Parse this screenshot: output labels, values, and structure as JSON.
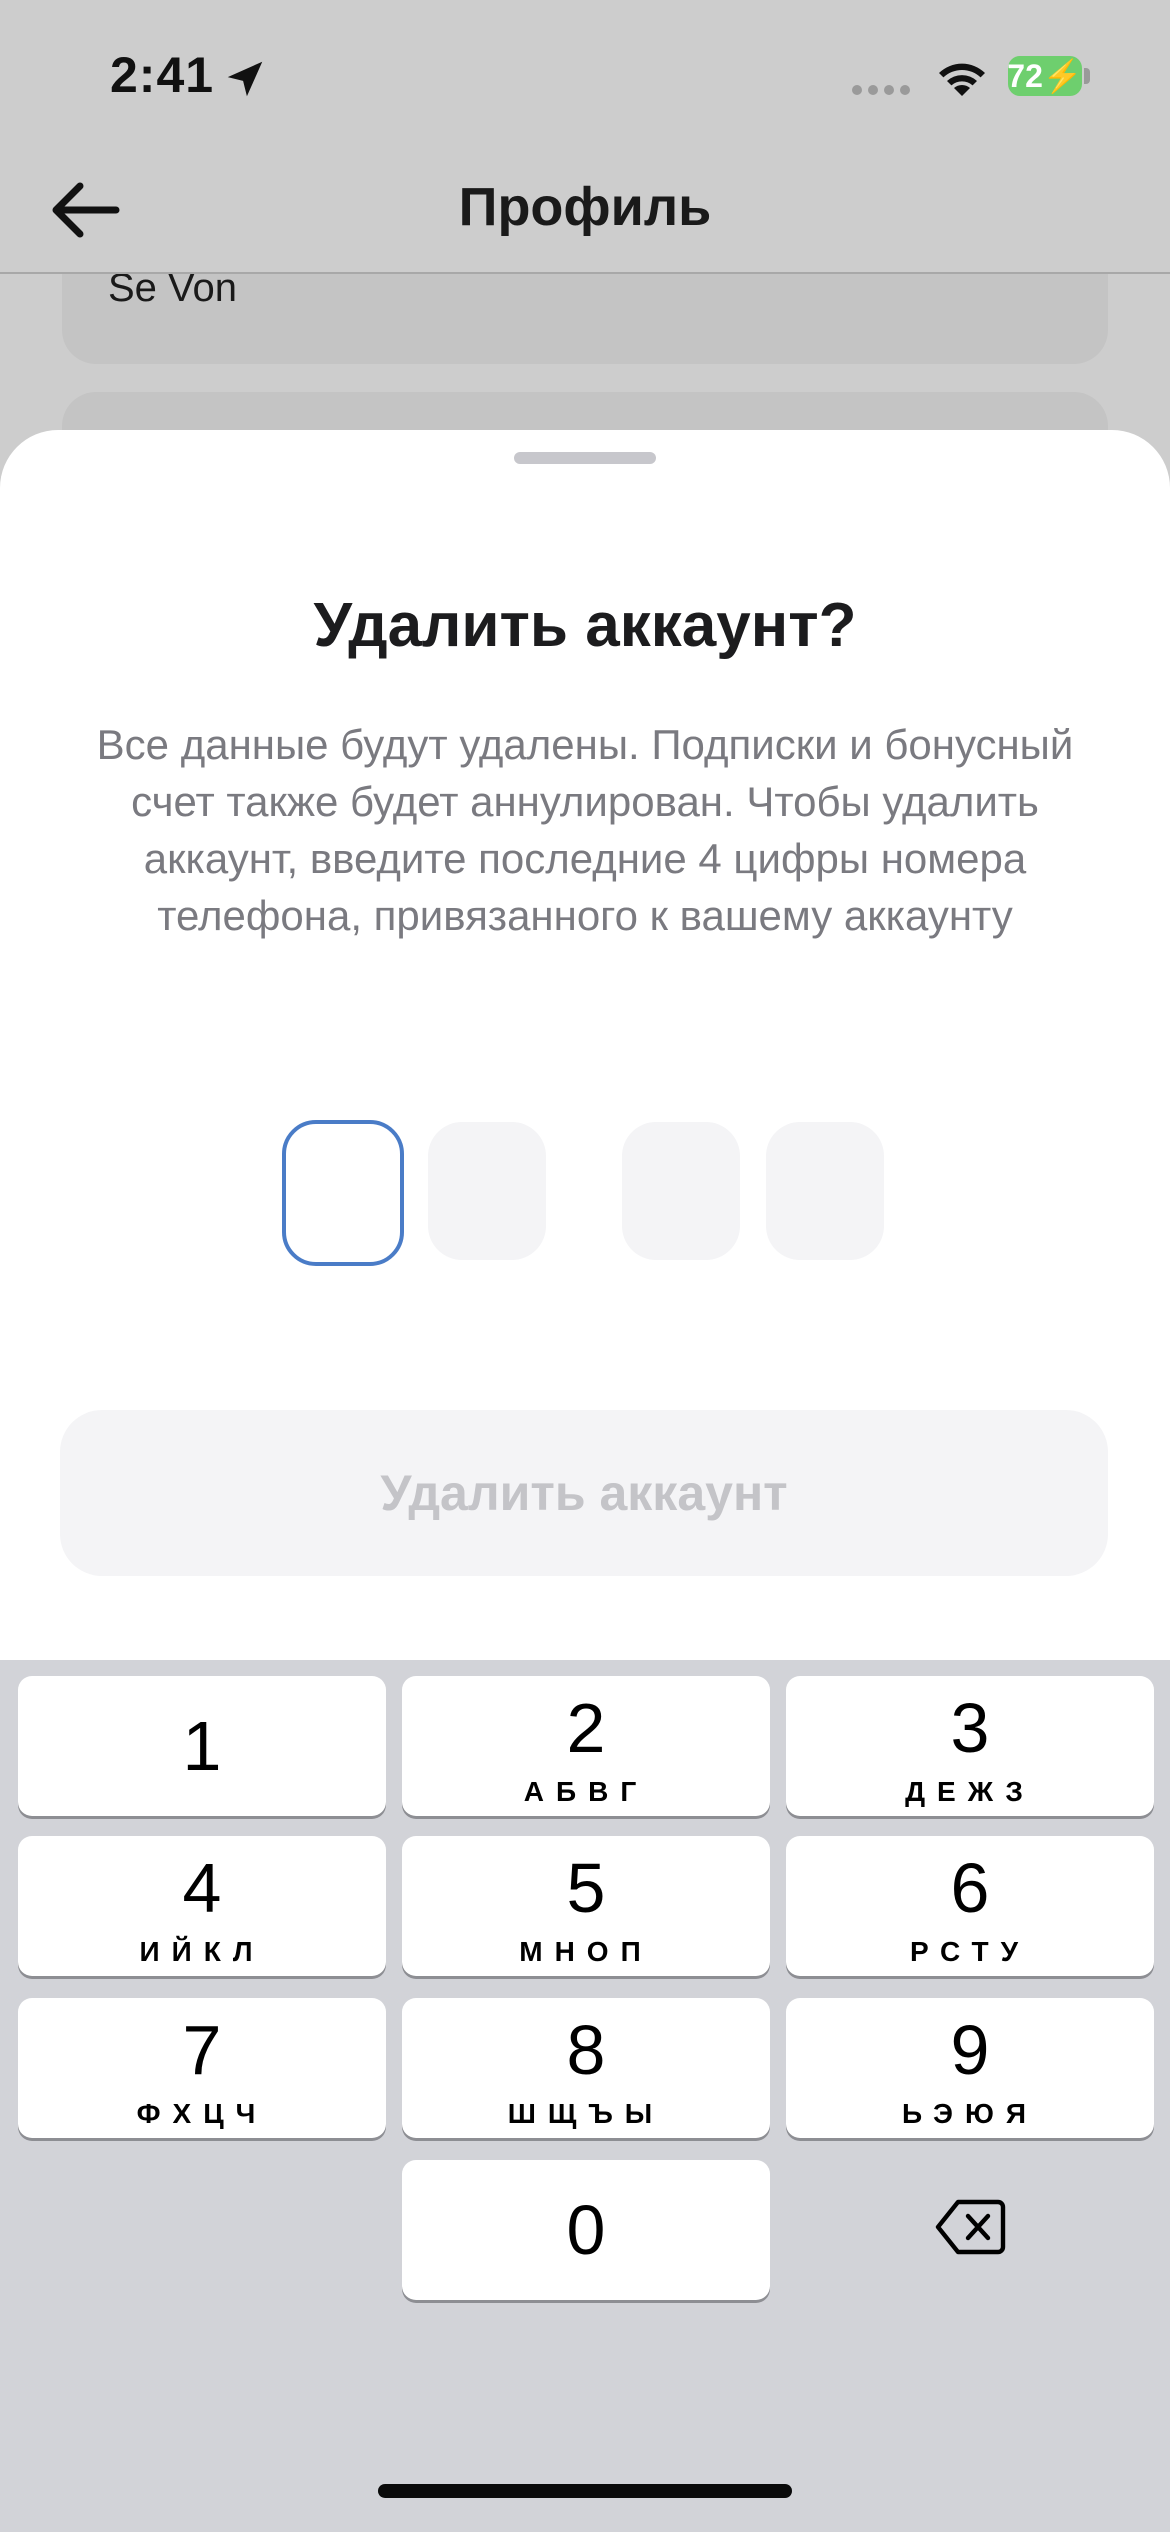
{
  "status_bar": {
    "time": "2:41",
    "battery": "72"
  },
  "nav": {
    "title": "Профиль"
  },
  "background": {
    "card_value": "Se Von"
  },
  "sheet": {
    "title": "Удалить аккаунт?",
    "description": "Все данные будут удалены. Подписки и бонусный счет также будет аннулирован. Чтобы удалить аккаунт, введите последние 4 цифры номера телефона, привязанного к вашему аккаунту",
    "code_digits": [
      "",
      "",
      "",
      ""
    ],
    "delete_button": "Удалить аккаунт"
  },
  "keypad": {
    "keys": [
      {
        "digit": "1",
        "letters": ""
      },
      {
        "digit": "2",
        "letters": "АБВГ"
      },
      {
        "digit": "3",
        "letters": "ДЕЖЗ"
      },
      {
        "digit": "4",
        "letters": "ИЙКЛ"
      },
      {
        "digit": "5",
        "letters": "МНОП"
      },
      {
        "digit": "6",
        "letters": "РСТУ"
      },
      {
        "digit": "7",
        "letters": "ФХЦЧ"
      },
      {
        "digit": "8",
        "letters": "ШЩЪЫ"
      },
      {
        "digit": "9",
        "letters": "ЬЭЮЯ"
      },
      {
        "digit": "0",
        "letters": ""
      }
    ]
  },
  "colors": {
    "accent": "#4a7cc7",
    "sheet_bg": "#ffffff",
    "dim_bg": "#cdcdcd",
    "keypad_bg": "#d2d3d8"
  },
  "icons": [
    "location-arrow-icon",
    "wifi-icon",
    "battery-icon",
    "back-arrow-icon",
    "chevron-down-icon",
    "backspace-icon"
  ]
}
